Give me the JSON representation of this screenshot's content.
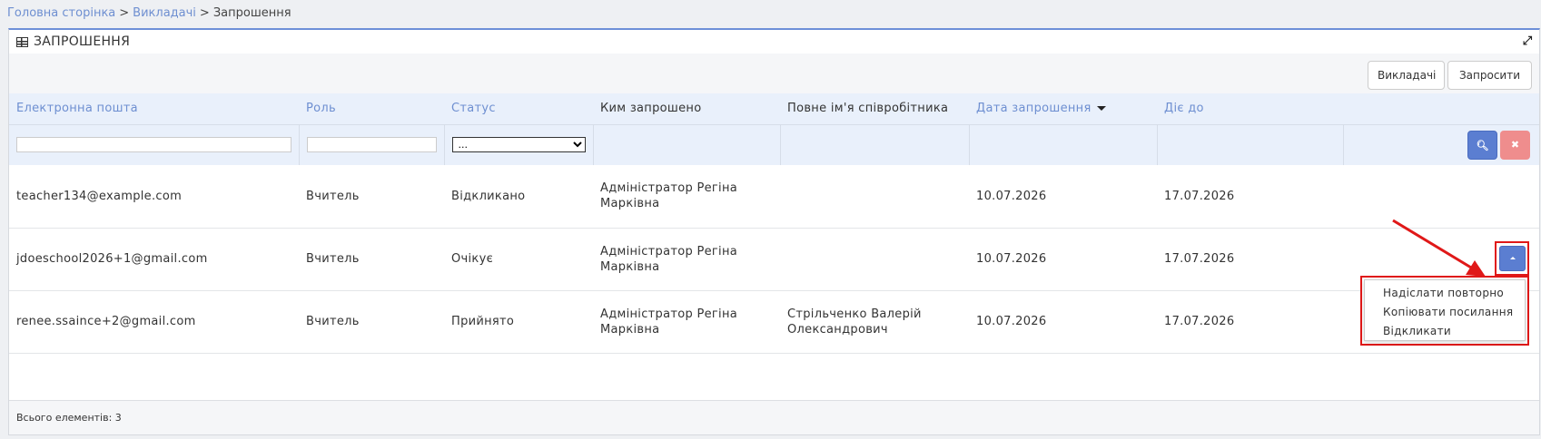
{
  "breadcrumb": {
    "home": "Головна сторінка",
    "teachers": "Викладачі",
    "current": "Запрошення",
    "separator": ">"
  },
  "panel": {
    "title": "ЗАПРОШЕННЯ",
    "expand_icon": "expand-icon"
  },
  "toolbar": {
    "teachers_label": "Викладачі",
    "invite_label": "Запросити"
  },
  "table": {
    "columns": [
      {
        "label": "Електронна пошта",
        "sortable": true
      },
      {
        "label": "Роль",
        "sortable": true
      },
      {
        "label": "Статус",
        "sortable": true
      },
      {
        "label": "Ким запрошено",
        "sortable": false
      },
      {
        "label": "Повне ім'я співробітника",
        "sortable": false
      },
      {
        "label": "Дата запрошення",
        "sortable": true,
        "sorted": "desc"
      },
      {
        "label": "Діє до",
        "sortable": true
      }
    ],
    "filters": {
      "status_select": "..."
    },
    "rows": [
      {
        "email": "teacher134@example.com",
        "role": "Вчитель",
        "status": "Відкликано",
        "invited_by": "Адміністратор Регіна Марківна",
        "employee": "",
        "invite_date": "10.07.2026",
        "valid_until": "17.07.2026"
      },
      {
        "email": "jdoeschool2026+1@gmail.com",
        "role": "Вчитель",
        "status": "Очікує",
        "invited_by": "Адміністратор Регіна Марківна",
        "employee": "",
        "invite_date": "10.07.2026",
        "valid_until": "17.07.2026"
      },
      {
        "email": "renee.ssaince+2@gmail.com",
        "role": "Вчитель",
        "status": "Прийнято",
        "invited_by": "Адміністратор Регіна Марківна",
        "employee": "Стрільченко Валерій Олександрович",
        "invite_date": "10.07.2026",
        "valid_until": "17.07.2026"
      }
    ]
  },
  "dropdown": {
    "items": [
      "Надіслати повторно",
      "Копіювати посилання",
      "Відкликати"
    ]
  },
  "footer": {
    "total": "Всього елементів: 3"
  },
  "colors": {
    "accent": "#5b7ed1",
    "highlight": "#e01818",
    "clear": "#ef8d8d"
  }
}
